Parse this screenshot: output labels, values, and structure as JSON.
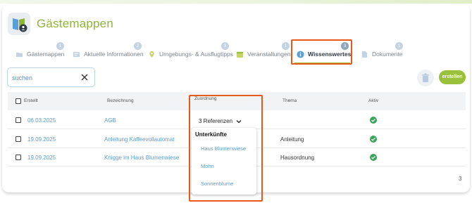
{
  "app": {
    "title": "Gästemappen"
  },
  "tabs": [
    {
      "label": "Gästemappen",
      "badge": "1",
      "icon": "folder-icon"
    },
    {
      "label": "Aktuelle Informationen",
      "badge": "2",
      "icon": "info-card-icon"
    },
    {
      "label": "Umgebungs- & Ausflugtipps",
      "badge": "3",
      "icon": "map-pin-icon"
    },
    {
      "label": "Veranstaltungen",
      "badge": "1",
      "icon": "calendar-icon"
    },
    {
      "label": "Wissenswertes",
      "badge": "3",
      "icon": "info-icon",
      "active": true
    },
    {
      "label": "Dokumente",
      "badge": "1",
      "icon": "document-icon"
    }
  ],
  "search": {
    "placeholder": "suchen"
  },
  "toolbar": {
    "create_label": "erstellen"
  },
  "table": {
    "headers": {
      "created": "Erstellt",
      "name": "Bezeichnung",
      "assignment": "Zuordnung",
      "topic": "Thema",
      "active": "Aktiv"
    },
    "rows": [
      {
        "created": "06.03.2025",
        "name": "AGB",
        "topic": "",
        "active": true
      },
      {
        "created": "19.09.2025",
        "name": "Anleitung Kaffeevollautomat",
        "topic": "Anleitung",
        "active": true
      },
      {
        "created": "19.09.2025",
        "name": "Knigge im Haus Blumenwiese",
        "topic": "Hausordnung",
        "active": true
      }
    ]
  },
  "references": {
    "trigger_label": "3 Referenzen",
    "group": "Unterkünfte",
    "items": [
      "Haus Blumenwiese",
      "Mohn",
      "Sonnenblume"
    ]
  },
  "pagination": {
    "total": "3"
  },
  "colors": {
    "accent": "#9ac13c",
    "link": "#5a9cd1",
    "highlight": "#e8581b",
    "active_check": "#3aa55a"
  }
}
